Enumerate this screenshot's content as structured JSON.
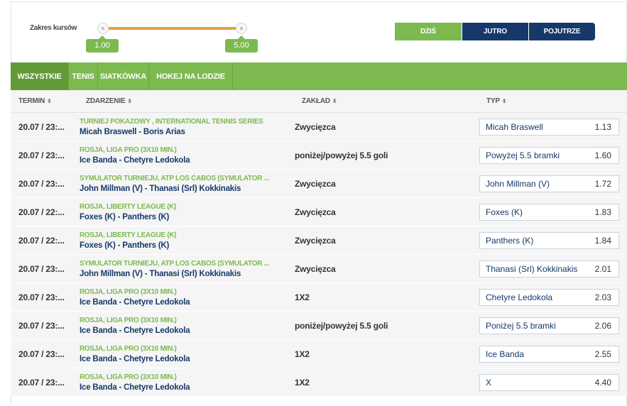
{
  "filter": {
    "range_label": "Zakres kursów",
    "min_value": "1.00",
    "max_value": "5.00"
  },
  "days": [
    "DZIŚ",
    "JUTRO",
    "POJUTRZE"
  ],
  "tabs": [
    "WSZYSTKIE",
    "TENIS",
    "SIATKÓWKA",
    "HOKEJ NA LODZIE"
  ],
  "columns": [
    "TERMIN",
    "ZDARZENIE",
    "ZAKŁAD",
    "TYP"
  ],
  "sort_icon": "⬍",
  "colors": {
    "green": "#7cba4f",
    "navy": "#16396a"
  },
  "rows": [
    {
      "date": "20.07 / 23:...",
      "league": "TURNIEJ POKAZOWY , INTERNATIONAL TENNIS SERIES",
      "match": "Micah Braswell - Boris Arias",
      "bet": "Zwycięzca",
      "pick": "Micah Braswell",
      "odd": "1.13"
    },
    {
      "date": "20.07 / 23:...",
      "league": "ROSJA, LIGA PRO (3X10 MIN.)",
      "match": "Ice Banda - Chetyre Ledokola",
      "bet": "poniżej/powyżej 5.5 goli",
      "pick": "Powyżej 5.5 bramki",
      "odd": "1.60"
    },
    {
      "date": "20.07 / 23:...",
      "league": "SYMULATOR TURNIEJU, ATP LOS CABOS (SYMULATOR ...",
      "match": "John Millman (V) - Thanasi (Srl) Kokkinakis",
      "bet": "Zwycięzca",
      "pick": "John Millman (V)",
      "odd": "1.72"
    },
    {
      "date": "20.07 / 22:...",
      "league": "ROSJA, LIBERTY LEAGUE (K)",
      "match": "Foxes (K) - Panthers (K)",
      "bet": "Zwycięzca",
      "pick": "Foxes (K)",
      "odd": "1.83"
    },
    {
      "date": "20.07 / 22:...",
      "league": "ROSJA, LIBERTY LEAGUE (K)",
      "match": "Foxes (K) - Panthers (K)",
      "bet": "Zwycięzca",
      "pick": "Panthers (K)",
      "odd": "1.84"
    },
    {
      "date": "20.07 / 23:...",
      "league": "SYMULATOR TURNIEJU, ATP LOS CABOS (SYMULATOR ...",
      "match": "John Millman (V) - Thanasi (Srl) Kokkinakis",
      "bet": "Zwycięzca",
      "pick": "Thanasi (Srl) Kokkinakis",
      "odd": "2.01"
    },
    {
      "date": "20.07 / 23:...",
      "league": "ROSJA, LIGA PRO (3X10 MIN.)",
      "match": "Ice Banda - Chetyre Ledokola",
      "bet": "1X2",
      "pick": "Chetyre Ledokola",
      "odd": "2.03"
    },
    {
      "date": "20.07 / 23:...",
      "league": "ROSJA, LIGA PRO (3X10 MIN.)",
      "match": "Ice Banda - Chetyre Ledokola",
      "bet": "poniżej/powyżej 5.5 goli",
      "pick": "Poniżej 5.5 bramki",
      "odd": "2.06"
    },
    {
      "date": "20.07 / 23:...",
      "league": "ROSJA, LIGA PRO (3X10 MIN.)",
      "match": "Ice Banda - Chetyre Ledokola",
      "bet": "1X2",
      "pick": "Ice Banda",
      "odd": "2.55"
    },
    {
      "date": "20.07 / 23:...",
      "league": "ROSJA, LIGA PRO (3X10 MIN.)",
      "match": "Ice Banda - Chetyre Ledokola",
      "bet": "1X2",
      "pick": "X",
      "odd": "4.40"
    }
  ]
}
